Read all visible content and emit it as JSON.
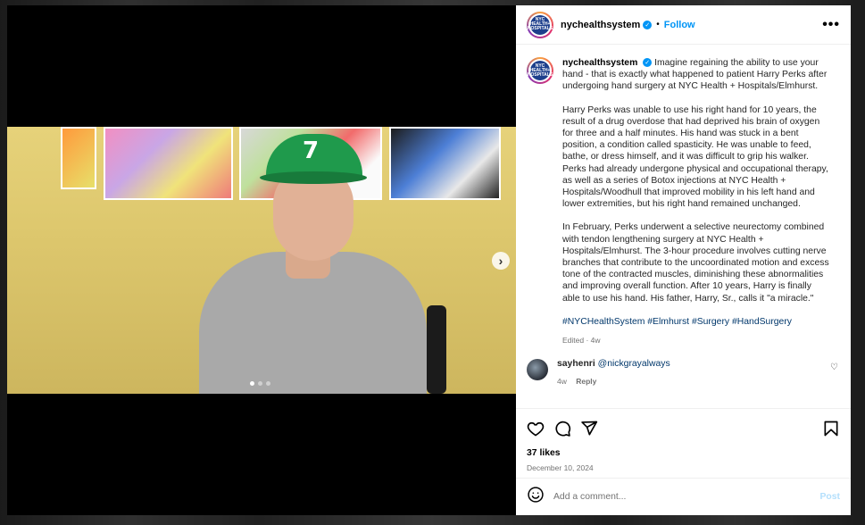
{
  "post": {
    "username": "nychealthsystem",
    "follow_label": "Follow",
    "bullet": "•",
    "more_label": "•••",
    "avatar_text": "NYC HEALTH+ HOSPITALS"
  },
  "caption": {
    "username": "nychealthsystem",
    "intro": "Imagine regaining the ability to use your hand - that is exactly what happened to patient Harry Perks after undergoing hand surgery at NYC Health + Hospitals/Elmhurst.",
    "para1": "Harry Perks was unable to use his right hand for 10 years, the result of a drug overdose that had deprived his brain of oxygen for three and a half minutes. His hand was stuck in a bent position, a condition called spasticity. He was unable to feed, bathe, or dress himself, and it was difficult to grip his walker. Perks had already undergone physical and occupational therapy, as well as a series of Botox injections at NYC Health + Hospitals/Woodhull that improved mobility in his left hand and lower extremities, but his right hand remained unchanged.",
    "para2": "In February, Perks underwent a selective neurectomy combined with tendon lengthening surgery at NYC Health + Hospitals/Elmhurst. The 3-hour procedure involves cutting nerve branches that contribute to the uncoordinated motion and excess tone of the contracted muscles, diminishing these abnormalities and improving overall function. After 10 years, Harry is finally able to use his hand. His father, Harry, Sr., calls it \"a miracle.\"",
    "hashtags": "#NYCHealthSystem #Elmhurst #Surgery #HandSurgery",
    "edited": "Edited · 4w"
  },
  "comment": {
    "username": "sayhenri",
    "mention": "@nickgrayalways",
    "time": "4w",
    "reply_label": "Reply"
  },
  "media": {
    "hat_number": "7",
    "next_arrow": "›",
    "slide_count": 3,
    "active_slide": 1
  },
  "engagement": {
    "likes": "37 likes",
    "date": "December 10, 2024"
  },
  "add_comment": {
    "placeholder": "Add a comment...",
    "post_label": "Post"
  },
  "colors": {
    "accent": "#0095f6",
    "hashtag": "#00376b",
    "post_disabled": "#b3dffc"
  },
  "icons": [
    "verified-icon",
    "more-icon",
    "heart-icon",
    "comment-icon",
    "share-icon",
    "bookmark-icon",
    "emoji-icon",
    "chevron-right-icon"
  ]
}
